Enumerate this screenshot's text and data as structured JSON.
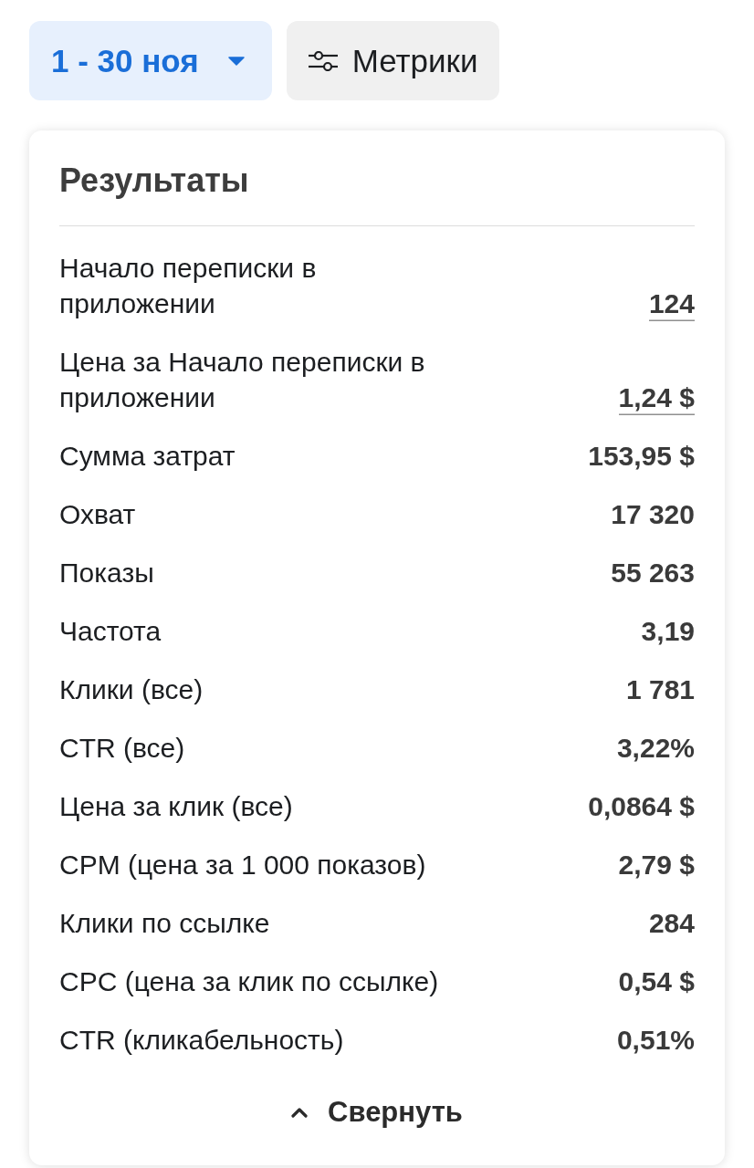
{
  "toolbar": [
    {
      "kind": "dropdown",
      "label": "1 - 30 ноя",
      "selected": true
    },
    {
      "kind": "metrics",
      "label": "Метрики",
      "selected": false
    }
  ],
  "results": {
    "title": "Результаты",
    "rows": [
      {
        "label": "Начало переписки в приложении",
        "value": "124",
        "underlined": true
      },
      {
        "label": "Цена за Начало переписки в приложении",
        "value": "1,24 $",
        "underlined": true
      },
      {
        "label": "Сумма затрат",
        "value": "153,95 $",
        "underlined": false
      },
      {
        "label": "Охват",
        "value": "17 320",
        "underlined": false
      },
      {
        "label": "Показы",
        "value": "55 263",
        "underlined": false
      },
      {
        "label": "Частота",
        "value": "3,19",
        "underlined": false
      },
      {
        "label": "Клики (все)",
        "value": "1 781",
        "underlined": false
      },
      {
        "label": "CTR (все)",
        "value": "3,22%",
        "underlined": false
      },
      {
        "label": "Цена за клик (все)",
        "value": "0,0864 $",
        "underlined": false
      },
      {
        "label": "CPM (цена за 1 000 показов)",
        "value": "2,79 $",
        "underlined": false
      },
      {
        "label": "Клики по ссылке",
        "value": "284",
        "underlined": false
      },
      {
        "label": "CPC (цена за клик по ссылке)",
        "value": "0,54 $",
        "underlined": false
      },
      {
        "label": "CTR (кликабельность)",
        "value": "0,51%",
        "underlined": false
      }
    ],
    "collapse_button": {
      "label": "Свернуть"
    }
  }
}
